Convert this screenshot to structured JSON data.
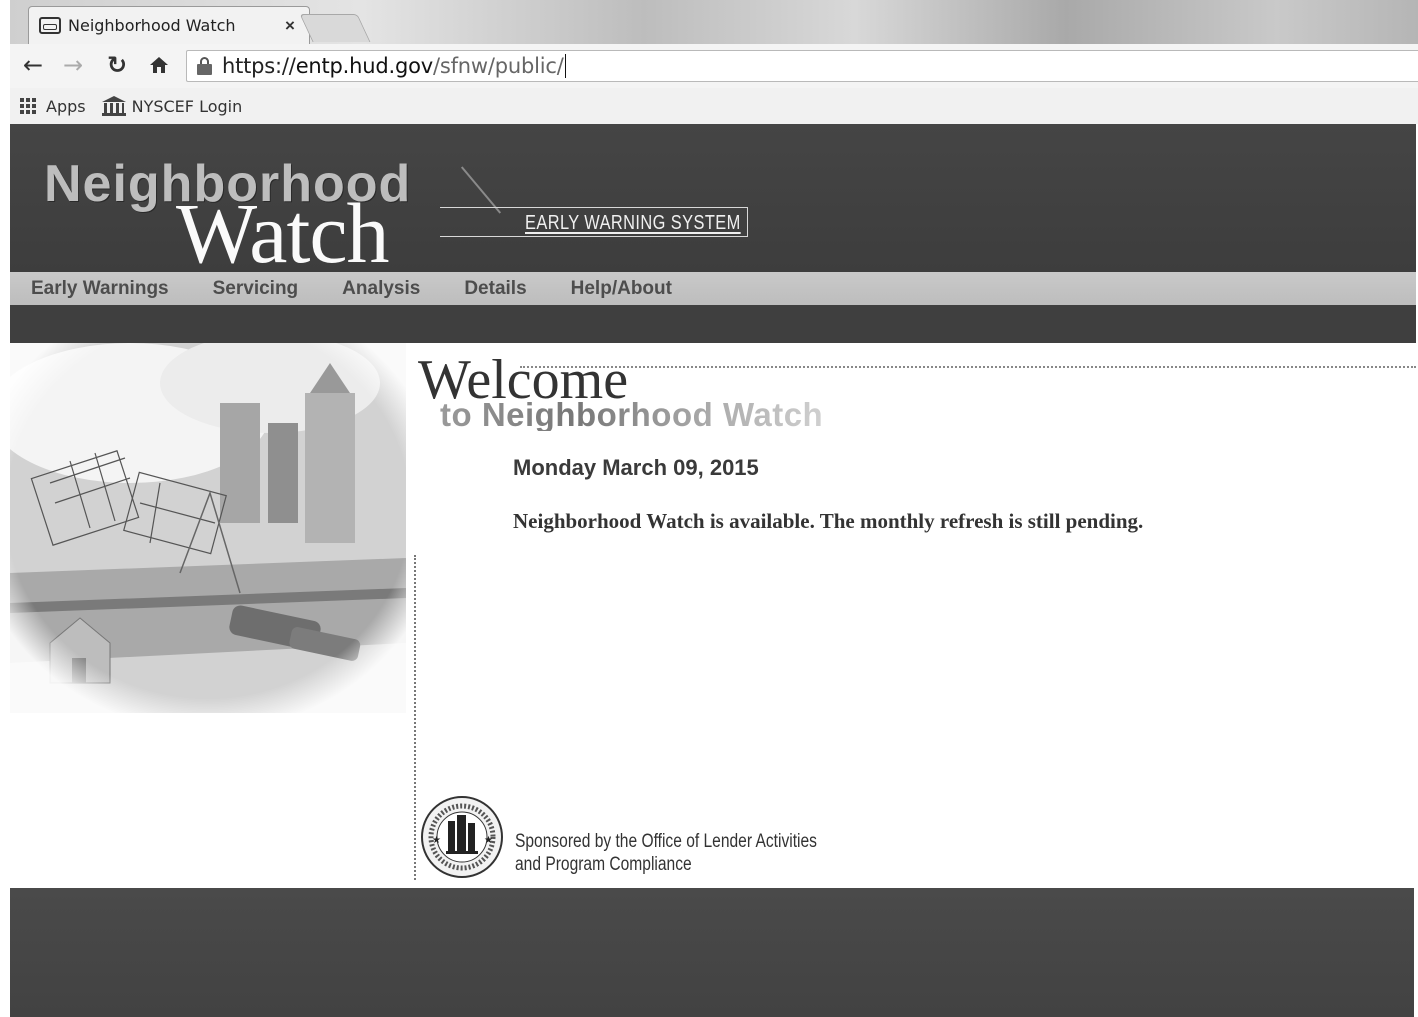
{
  "browser": {
    "tab_title": "Neighborhood Watch",
    "tab_close": "×",
    "url_scheme": "https://",
    "url_host": "entp.hud.gov",
    "url_path": "/sfnw/public/",
    "bookmarks": [
      {
        "label": "Apps",
        "icon": "apps-grid-icon"
      },
      {
        "label": "NYSCEF Login",
        "icon": "bank-building-icon"
      }
    ]
  },
  "header": {
    "logo_line1": "Neighborhood",
    "logo_line2": "Watch",
    "tagline": "EARLY WARNING SYSTEM"
  },
  "nav": {
    "items": [
      "Early Warnings",
      "Servicing",
      "Analysis",
      "Details",
      "Help/About"
    ]
  },
  "main": {
    "welcome_title": "Welcome",
    "welcome_subtitle": "to Neighborhood Watch",
    "date": "Monday March 09, 2015",
    "status_message": "Neighborhood Watch is available. The monthly refresh is still pending.",
    "sponsor_line1": "Sponsored by the Office of Lender Activities",
    "sponsor_line2": "and Program Compliance"
  },
  "colors": {
    "header_bg": "#454545",
    "nav_bg": "#c9c9c9",
    "footer_bg": "#4a4a4a"
  }
}
